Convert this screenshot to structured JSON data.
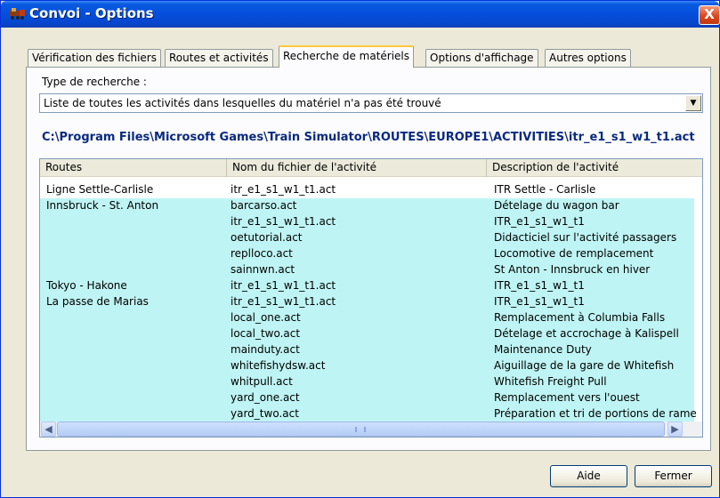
{
  "window": {
    "title": "Convoi - Options",
    "close_label": "X"
  },
  "tabs": [
    {
      "label": "Vérification des fichiers"
    },
    {
      "label": "Routes et activités"
    },
    {
      "label": "Recherche de matériels"
    },
    {
      "label": "Options d'affichage"
    },
    {
      "label": "Autres options"
    }
  ],
  "search": {
    "type_label": "Type de recherche :",
    "selected_option": "Liste de toutes les activités dans lesquelles du matériel n'a pas été trouvé",
    "path": "C:\\Program Files\\Microsoft Games\\Train Simulator\\ROUTES\\EUROPE1\\ACTIVITIES\\itr_e1_s1_w1_t1.act"
  },
  "list": {
    "columns": [
      "Routes",
      "Nom du fichier de l'activité",
      "Description de l'activité"
    ],
    "rows": [
      {
        "route": "Ligne Settle-Carlisle",
        "file": "itr_e1_s1_w1_t1.act",
        "description": "ITR Settle - Carlisle",
        "highlight": false
      },
      {
        "route": "Innsbruck - St. Anton",
        "file": "barcarso.act",
        "description": "Dételage du wagon bar",
        "highlight": true
      },
      {
        "route": "",
        "file": "itr_e1_s1_w1_t1.act",
        "description": "ITR_e1_s1_w1_t1",
        "highlight": true
      },
      {
        "route": "",
        "file": "oetutorial.act",
        "description": "Didacticiel sur l'activité passagers",
        "highlight": true
      },
      {
        "route": "",
        "file": "replloco.act",
        "description": "Locomotive de remplacement",
        "highlight": true
      },
      {
        "route": "",
        "file": "sainnwn.act",
        "description": "St Anton - Innsbruck en hiver",
        "highlight": true
      },
      {
        "route": "Tokyo - Hakone",
        "file": "itr_e1_s1_w1_t1.act",
        "description": "ITR_e1_s1_w1_t1",
        "highlight": true
      },
      {
        "route": "La passe de Marias",
        "file": "itr_e1_s1_w1_t1.act",
        "description": "ITR_e1_s1_w1_t1",
        "highlight": true
      },
      {
        "route": "",
        "file": "local_one.act",
        "description": "Remplacement à Columbia Falls",
        "highlight": true
      },
      {
        "route": "",
        "file": "local_two.act",
        "description": "Dételage et accrochage à Kalispell",
        "highlight": true
      },
      {
        "route": "",
        "file": "mainduty.act",
        "description": "Maintenance Duty",
        "highlight": true
      },
      {
        "route": "",
        "file": "whitefishydsw.act",
        "description": "Aiguillage de la gare de Whitefish",
        "highlight": true
      },
      {
        "route": "",
        "file": "whitpull.act",
        "description": "Whitefish Freight Pull",
        "highlight": true
      },
      {
        "route": "",
        "file": "yard_one.act",
        "description": "Remplacement vers l'ouest",
        "highlight": true
      },
      {
        "route": "",
        "file": "yard_two.act",
        "description": "Préparation et tri de portions de rame",
        "highlight": true
      }
    ]
  },
  "buttons": {
    "help": "Aide",
    "close": "Fermer"
  },
  "colors": {
    "title_bar": "#0550dd",
    "row_highlight": "#bff4f4",
    "path_text": "#0a2a7e"
  },
  "icons": {
    "app": "train-icon",
    "dropdown": "chevron-down-icon",
    "scroll_left": "arrow-left-icon",
    "scroll_right": "arrow-right-icon"
  }
}
